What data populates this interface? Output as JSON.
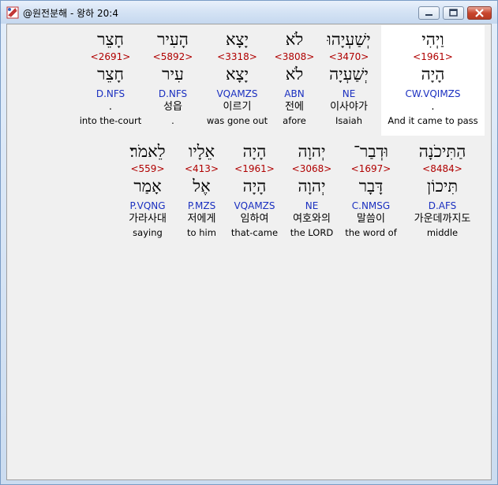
{
  "window": {
    "title": "@원전분해 - 왕하 20:4",
    "buttons": {
      "minimize": "minimize-icon",
      "maximize": "maximize-icon",
      "close": "close-icon"
    }
  },
  "rows": [
    {
      "words": [
        {
          "heb": "וַיְהִי",
          "strong": "<1961>",
          "lemma": "הָיָה",
          "gram": "CW.VQIMZS",
          "kor": ".",
          "eng": "And it came to pass",
          "highlighted": true
        },
        {
          "heb": "יְשַׁעְיָהוּ",
          "strong": "<3470>",
          "lemma": "יְשַׁעְיָה",
          "gram": "NE",
          "kor": "이사야가",
          "eng": "Isaiah"
        },
        {
          "heb": "לֹא",
          "strong": "<3808>",
          "lemma": "לֹא",
          "gram": "ABN",
          "kor": "전에",
          "eng": "afore"
        },
        {
          "heb": "יָצָא",
          "strong": "<3318>",
          "lemma": "יָצָא",
          "gram": "VQAMZS",
          "kor": "이르기",
          "eng": "was gone out"
        },
        {
          "heb": "הָעִיר",
          "strong": "<5892>",
          "lemma": "עִיר",
          "gram": "D.NFS",
          "kor": "성읍",
          "eng": "."
        },
        {
          "heb": "חָצֵר",
          "strong": "<2691>",
          "lemma": "חָצֵר",
          "gram": "D.NFS",
          "kor": ".",
          "eng": "into the-court"
        }
      ]
    },
    {
      "words": [
        {
          "heb": "הַתִּיכֹנָה",
          "strong": "<8484>",
          "lemma": "תִּיכוֹן",
          "gram": "D.AFS",
          "kor": "가운데까지도",
          "eng": "middle"
        },
        {
          "heb": "וּדְבַר־",
          "strong": "<1697>",
          "lemma": "דָּבָר",
          "gram": "C.NMSG",
          "kor": "말씀이",
          "eng": "the word of"
        },
        {
          "heb": "יְהוָה",
          "strong": "<3068>",
          "lemma": "יְהוָה",
          "gram": "NE",
          "kor": "여호와의",
          "eng": "the LORD"
        },
        {
          "heb": "הָיָה",
          "strong": "<1961>",
          "lemma": "הָיָה",
          "gram": "VQAMZS",
          "kor": "임하여",
          "eng": "that-came"
        },
        {
          "heb": "אֵלָיו",
          "strong": "<413>",
          "lemma": "אֶל",
          "gram": "P.MZS",
          "kor": "저에게",
          "eng": "to him"
        },
        {
          "heb": "לֵאמֹר׃",
          "strong": "<559>",
          "lemma": "אָמַר",
          "gram": "P.VQNG",
          "kor": "가라사대",
          "eng": "saying"
        }
      ]
    }
  ]
}
